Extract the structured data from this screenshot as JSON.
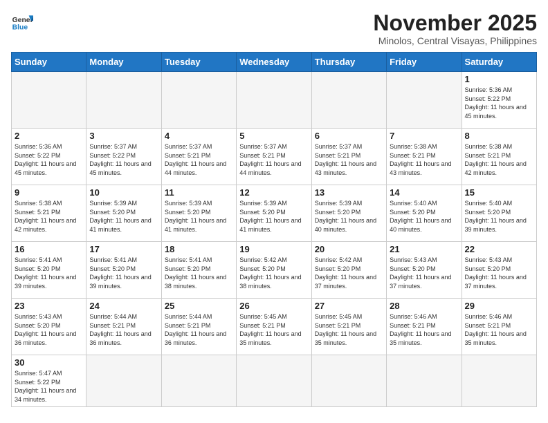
{
  "header": {
    "logo_general": "General",
    "logo_blue": "Blue",
    "month_title": "November 2025",
    "location": "Minolos, Central Visayas, Philippines"
  },
  "weekdays": [
    "Sunday",
    "Monday",
    "Tuesday",
    "Wednesday",
    "Thursday",
    "Friday",
    "Saturday"
  ],
  "days": [
    {
      "date": "",
      "info": ""
    },
    {
      "date": "",
      "info": ""
    },
    {
      "date": "",
      "info": ""
    },
    {
      "date": "",
      "info": ""
    },
    {
      "date": "",
      "info": ""
    },
    {
      "date": "",
      "info": ""
    },
    {
      "date": "1",
      "sunrise": "5:36 AM",
      "sunset": "5:22 PM",
      "daylight": "11 hours and 45 minutes."
    },
    {
      "date": "2",
      "sunrise": "5:36 AM",
      "sunset": "5:22 PM",
      "daylight": "11 hours and 45 minutes."
    },
    {
      "date": "3",
      "sunrise": "5:37 AM",
      "sunset": "5:22 PM",
      "daylight": "11 hours and 45 minutes."
    },
    {
      "date": "4",
      "sunrise": "5:37 AM",
      "sunset": "5:21 PM",
      "daylight": "11 hours and 44 minutes."
    },
    {
      "date": "5",
      "sunrise": "5:37 AM",
      "sunset": "5:21 PM",
      "daylight": "11 hours and 44 minutes."
    },
    {
      "date": "6",
      "sunrise": "5:37 AM",
      "sunset": "5:21 PM",
      "daylight": "11 hours and 43 minutes."
    },
    {
      "date": "7",
      "sunrise": "5:38 AM",
      "sunset": "5:21 PM",
      "daylight": "11 hours and 43 minutes."
    },
    {
      "date": "8",
      "sunrise": "5:38 AM",
      "sunset": "5:21 PM",
      "daylight": "11 hours and 42 minutes."
    },
    {
      "date": "9",
      "sunrise": "5:38 AM",
      "sunset": "5:21 PM",
      "daylight": "11 hours and 42 minutes."
    },
    {
      "date": "10",
      "sunrise": "5:39 AM",
      "sunset": "5:20 PM",
      "daylight": "11 hours and 41 minutes."
    },
    {
      "date": "11",
      "sunrise": "5:39 AM",
      "sunset": "5:20 PM",
      "daylight": "11 hours and 41 minutes."
    },
    {
      "date": "12",
      "sunrise": "5:39 AM",
      "sunset": "5:20 PM",
      "daylight": "11 hours and 41 minutes."
    },
    {
      "date": "13",
      "sunrise": "5:39 AM",
      "sunset": "5:20 PM",
      "daylight": "11 hours and 40 minutes."
    },
    {
      "date": "14",
      "sunrise": "5:40 AM",
      "sunset": "5:20 PM",
      "daylight": "11 hours and 40 minutes."
    },
    {
      "date": "15",
      "sunrise": "5:40 AM",
      "sunset": "5:20 PM",
      "daylight": "11 hours and 39 minutes."
    },
    {
      "date": "16",
      "sunrise": "5:41 AM",
      "sunset": "5:20 PM",
      "daylight": "11 hours and 39 minutes."
    },
    {
      "date": "17",
      "sunrise": "5:41 AM",
      "sunset": "5:20 PM",
      "daylight": "11 hours and 39 minutes."
    },
    {
      "date": "18",
      "sunrise": "5:41 AM",
      "sunset": "5:20 PM",
      "daylight": "11 hours and 38 minutes."
    },
    {
      "date": "19",
      "sunrise": "5:42 AM",
      "sunset": "5:20 PM",
      "daylight": "11 hours and 38 minutes."
    },
    {
      "date": "20",
      "sunrise": "5:42 AM",
      "sunset": "5:20 PM",
      "daylight": "11 hours and 37 minutes."
    },
    {
      "date": "21",
      "sunrise": "5:43 AM",
      "sunset": "5:20 PM",
      "daylight": "11 hours and 37 minutes."
    },
    {
      "date": "22",
      "sunrise": "5:43 AM",
      "sunset": "5:20 PM",
      "daylight": "11 hours and 37 minutes."
    },
    {
      "date": "23",
      "sunrise": "5:43 AM",
      "sunset": "5:20 PM",
      "daylight": "11 hours and 36 minutes."
    },
    {
      "date": "24",
      "sunrise": "5:44 AM",
      "sunset": "5:21 PM",
      "daylight": "11 hours and 36 minutes."
    },
    {
      "date": "25",
      "sunrise": "5:44 AM",
      "sunset": "5:21 PM",
      "daylight": "11 hours and 36 minutes."
    },
    {
      "date": "26",
      "sunrise": "5:45 AM",
      "sunset": "5:21 PM",
      "daylight": "11 hours and 35 minutes."
    },
    {
      "date": "27",
      "sunrise": "5:45 AM",
      "sunset": "5:21 PM",
      "daylight": "11 hours and 35 minutes."
    },
    {
      "date": "28",
      "sunrise": "5:46 AM",
      "sunset": "5:21 PM",
      "daylight": "11 hours and 35 minutes."
    },
    {
      "date": "29",
      "sunrise": "5:46 AM",
      "sunset": "5:21 PM",
      "daylight": "11 hours and 35 minutes."
    },
    {
      "date": "30",
      "sunrise": "5:47 AM",
      "sunset": "5:22 PM",
      "daylight": "11 hours and 34 minutes."
    }
  ],
  "labels": {
    "sunrise": "Sunrise:",
    "sunset": "Sunset:",
    "daylight": "Daylight:"
  }
}
